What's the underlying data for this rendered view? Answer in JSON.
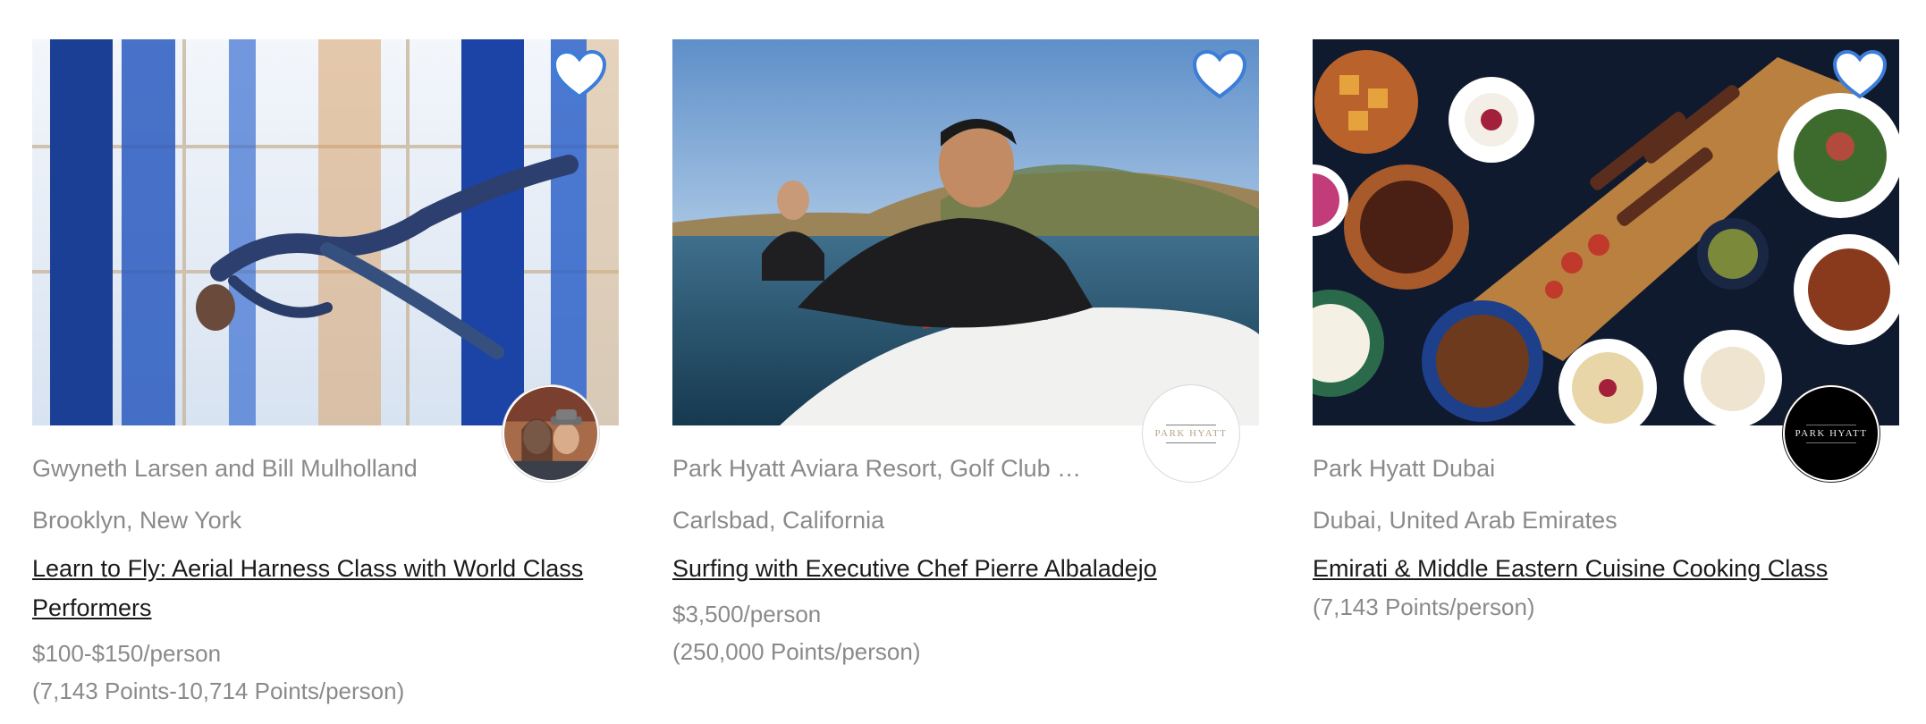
{
  "cards": [
    {
      "host": "Gwyneth Larsen and Bill Mulholland",
      "location": "Brooklyn, New York",
      "title": "Learn to Fly: Aerial Harness Class with World Class Performers",
      "price": "$100-$150/person",
      "points": "(7,143 Points-10,714 Points/person)",
      "avatar_type": "photo"
    },
    {
      "host": "Park Hyatt Aviara Resort, Golf Club …",
      "location": "Carlsbad, California",
      "title": "Surfing with Executive Chef Pierre Albaladejo",
      "price": "$3,500/person",
      "points": "(250,000 Points/person)",
      "avatar_type": "logo-light",
      "avatar_text": "PARK HYATT"
    },
    {
      "host": "Park Hyatt Dubai",
      "location": "Dubai, United Arab Emirates",
      "title": "Emirati & Middle Eastern Cuisine Cooking Class",
      "price": "",
      "points": "(7,143 Points/person)",
      "avatar_type": "logo-dark",
      "avatar_text": "PARK HYATT"
    }
  ],
  "colors": {
    "heart_stroke": "#3b7dd8",
    "muted_text": "#8a8a8a",
    "title_text": "#1a1a1a"
  },
  "icons": {
    "favorite": "heart-outline-icon"
  }
}
